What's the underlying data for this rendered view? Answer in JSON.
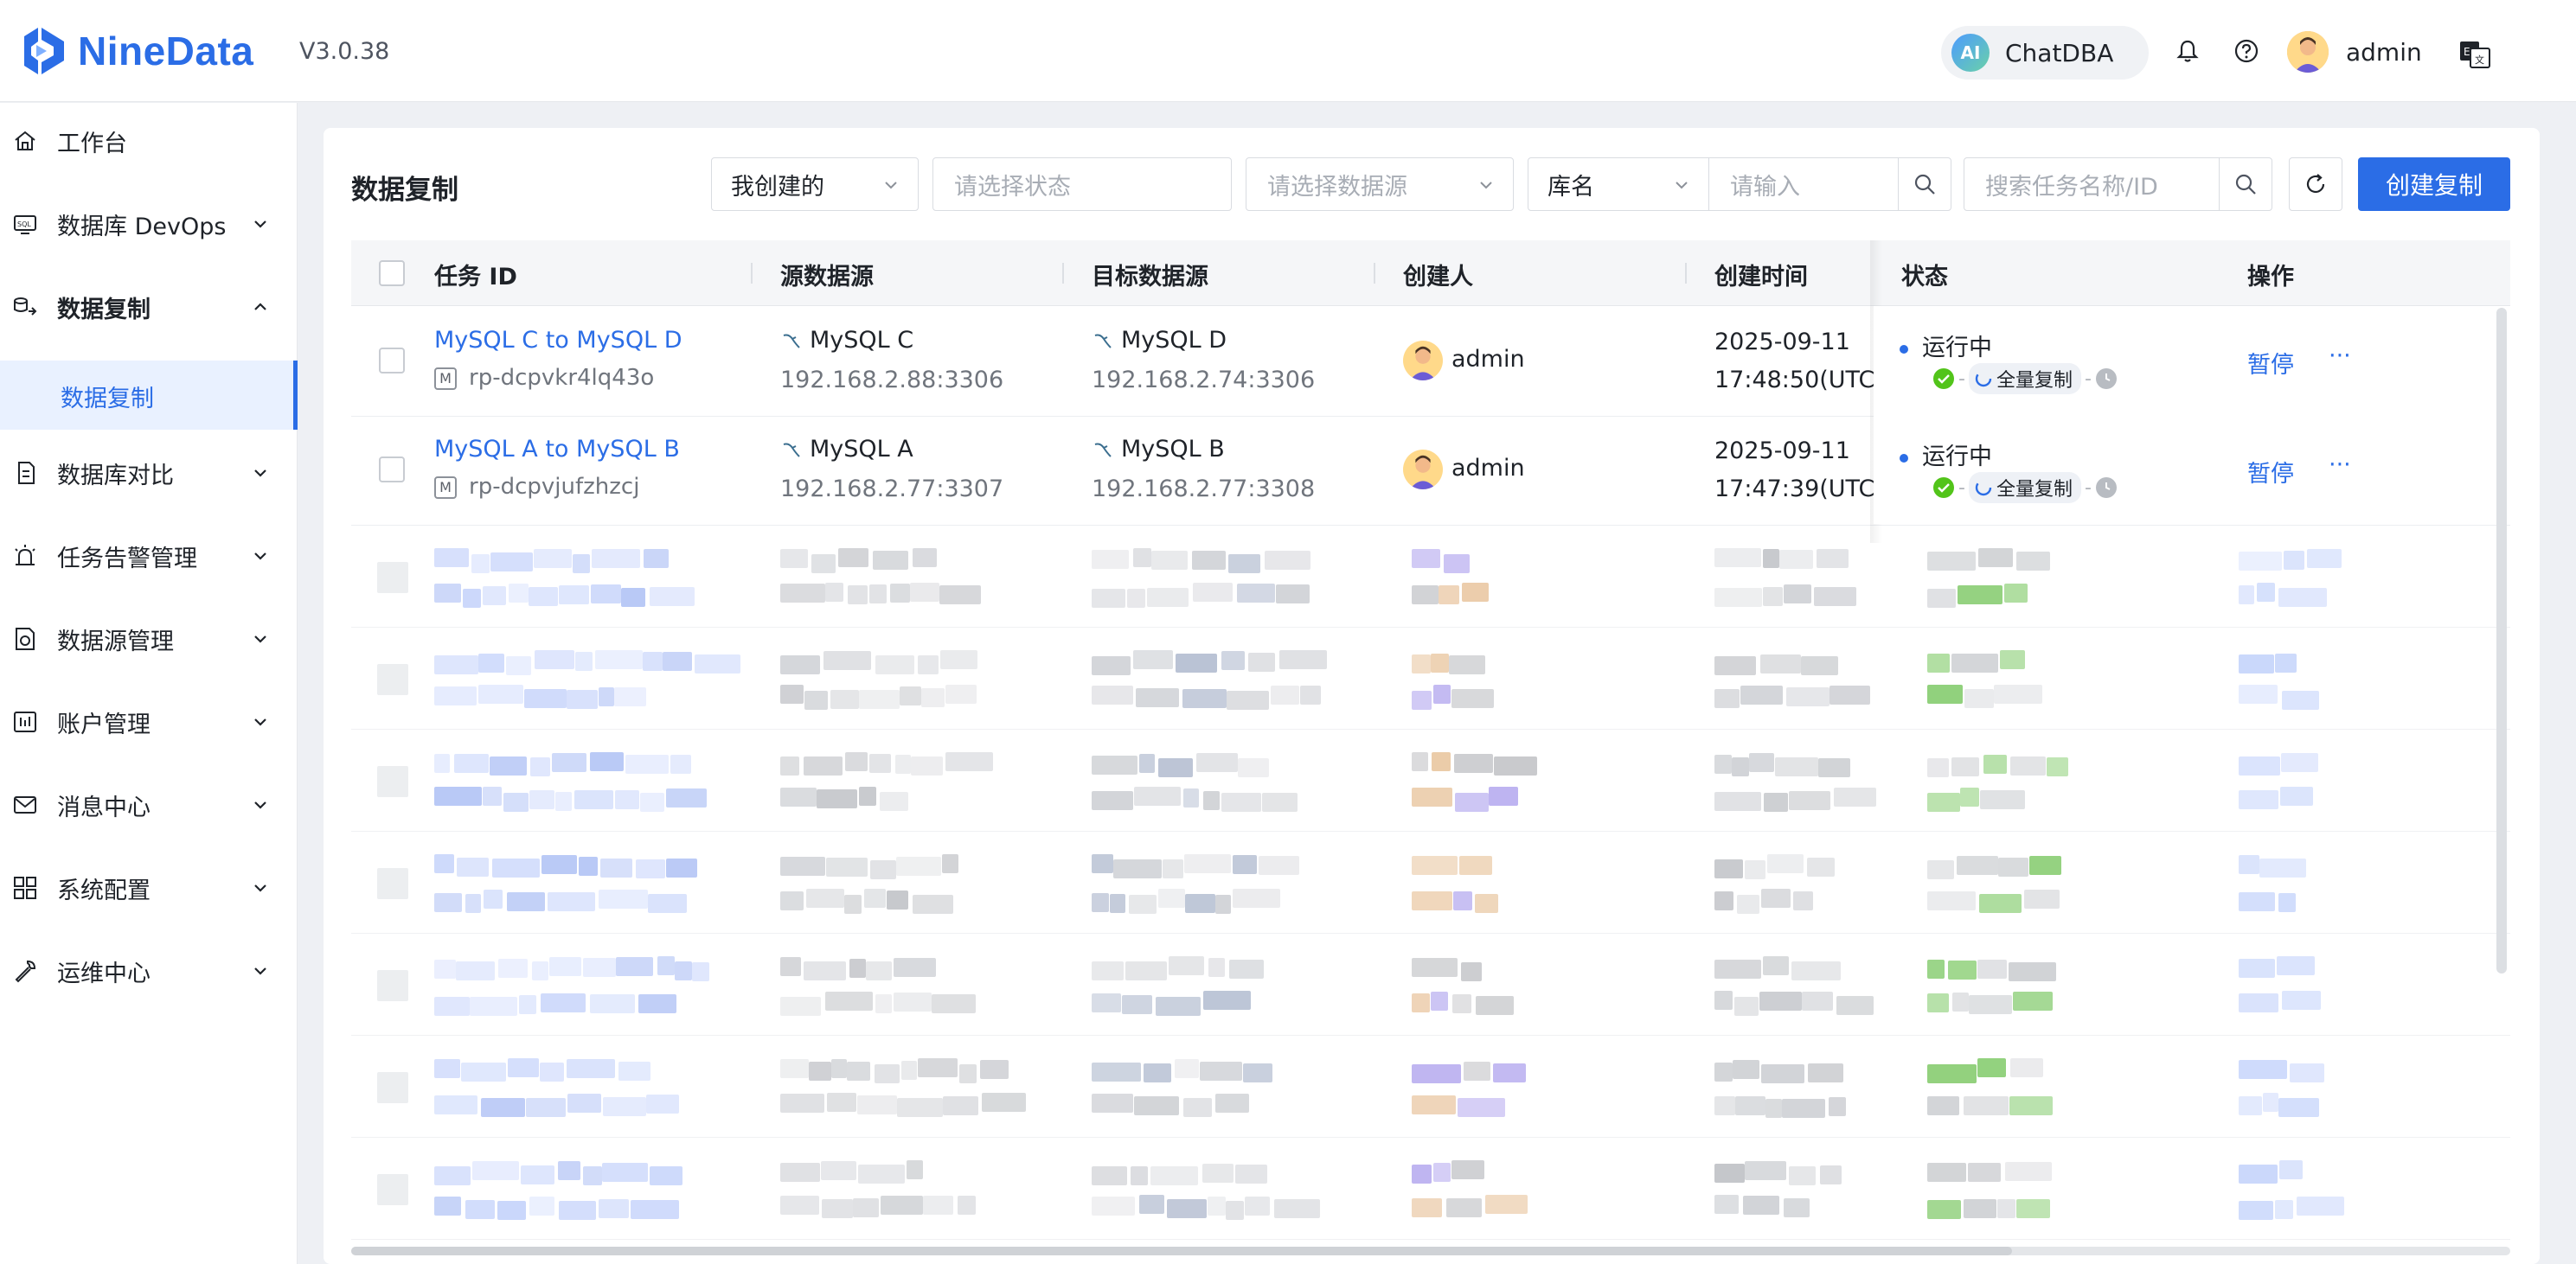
{
  "header": {
    "brand": "NineData",
    "version": "V3.0.38",
    "chatdba_badge": "AI",
    "chatdba_label": "ChatDBA",
    "user_name": "admin"
  },
  "sidebar": {
    "items": [
      {
        "label": "工作台",
        "icon": "home-icon"
      },
      {
        "label": "数据库 DevOps",
        "icon": "sql-icon"
      },
      {
        "label": "数据复制",
        "icon": "replication-icon"
      },
      {
        "label": "数据库对比",
        "icon": "compare-icon"
      },
      {
        "label": "任务告警管理",
        "icon": "alarm-icon"
      },
      {
        "label": "数据源管理",
        "icon": "datasource-icon"
      },
      {
        "label": "账户管理",
        "icon": "account-icon"
      },
      {
        "label": "消息中心",
        "icon": "mail-icon"
      },
      {
        "label": "系统配置",
        "icon": "grid-icon"
      },
      {
        "label": "运维中心",
        "icon": "wrench-icon"
      }
    ],
    "sub_item": "数据复制"
  },
  "toolbar": {
    "title": "数据复制",
    "owner_filter": "我创建的",
    "status_placeholder": "请选择状态",
    "datasource_placeholder": "请选择数据源",
    "db_select": "库名",
    "db_input_placeholder": "请输入",
    "task_search_placeholder": "搜索任务名称/ID",
    "create_button": "创建复制"
  },
  "table": {
    "columns": [
      "任务 ID",
      "源数据源",
      "目标数据源",
      "创建人",
      "创建时间",
      "状态",
      "操作"
    ],
    "rows": [
      {
        "name": "MySQL C to MySQL D",
        "id": "rp-dcpvkr4lq43o",
        "id_badge": "M",
        "source_name": "MySQL C",
        "source_addr": "192.168.2.88:3306",
        "target_name": "MySQL D",
        "target_addr": "192.168.2.74:3306",
        "creator": "admin",
        "created_date": "2025-09-11",
        "created_time": "17:48:50(UTC",
        "status": "运行中",
        "phase": "全量复制",
        "action": "暂停",
        "more": "···"
      },
      {
        "name": "MySQL A to MySQL B",
        "id": "rp-dcpvjufzhzcj",
        "id_badge": "M",
        "source_name": "MySQL A",
        "source_addr": "192.168.2.77:3307",
        "target_name": "MySQL B",
        "target_addr": "192.168.2.77:3308",
        "creator": "admin",
        "created_date": "2025-09-11",
        "created_time": "17:47:39(UTC",
        "status": "运行中",
        "phase": "全量复制",
        "action": "暂停",
        "more": "···"
      }
    ]
  },
  "colors": {
    "brand": "#2b6de6",
    "success": "#52c41a",
    "text": "#1f2329",
    "muted": "#70757d"
  }
}
